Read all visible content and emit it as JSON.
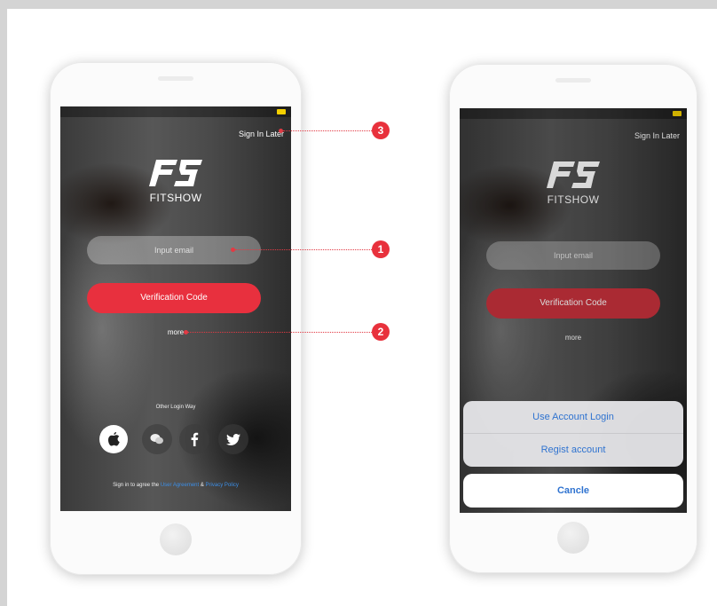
{
  "left_phone": {
    "sign_in_later": "Sign In Later",
    "brand_name": "FITSHOW",
    "email_placeholder": "Input email",
    "verification_button": "Verification Code",
    "more_link": "more",
    "other_login_label": "Other Login Way",
    "social_icons": [
      "apple-icon",
      "wechat-icon",
      "facebook-icon",
      "twitter-icon"
    ],
    "agree_prefix": "Sign in to agree the",
    "agree_link1": "User Agreement",
    "agree_and": "&",
    "agree_link2": "Privacy Policy"
  },
  "right_phone": {
    "sign_in_later": "Sign In Later",
    "brand_name": "FITSHOW",
    "email_placeholder": "Input email",
    "verification_button": "Verification Code",
    "more_link": "more",
    "action_sheet": {
      "option1": "Use Account Login",
      "option2": "Regist account",
      "cancel": "Cancle"
    }
  },
  "callouts": {
    "badge1": "1",
    "badge2": "2",
    "badge3": "3"
  },
  "colors": {
    "accent_red": "#e8303e",
    "link_blue": "#2f73d0",
    "background_gray": "#d4d4d4"
  }
}
